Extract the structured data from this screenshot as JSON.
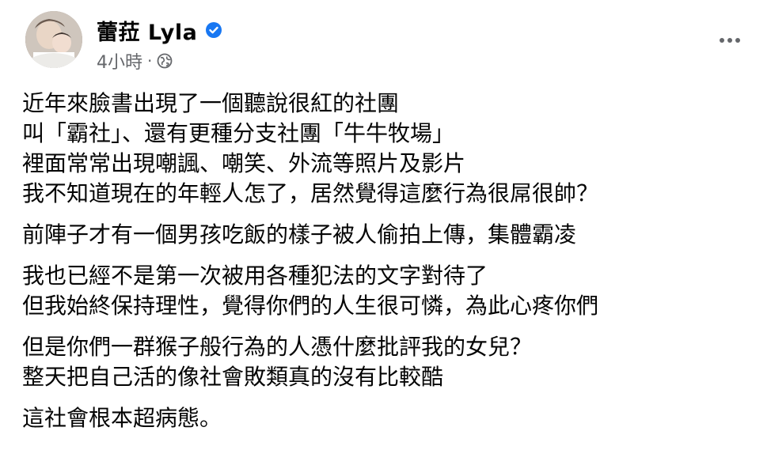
{
  "post": {
    "author": "蕾菈 Lyla",
    "verified": true,
    "time": "4小時",
    "separator": "·",
    "audience_icon": "globe-icon",
    "more_icon": "more-options-icon"
  },
  "body": {
    "paragraphs": [
      {
        "lines": [
          "近年來臉書出現了一個聽說很紅的社團",
          "叫「霸社」、還有更種分支社團「牛牛牧場」",
          "裡面常常出現嘲諷、嘲笑、外流等照片及影片",
          "我不知道現在的年輕人怎了，居然覺得這麼行為很屌很帥？"
        ]
      },
      {
        "lines": [
          "前陣子才有一個男孩吃飯的樣子被人偷拍上傳，集體霸凌"
        ]
      },
      {
        "lines": [
          "我也已經不是第一次被用各種犯法的文字對待了",
          "但我始終保持理性，覺得你們的人生很可憐，為此心疼你們"
        ]
      },
      {
        "lines": [
          "但是你們一群猴子般行為的人憑什麼批評我的女兒？",
          "整天把自己活的像社會敗類真的沒有比較酷"
        ]
      },
      {
        "lines": [
          "這社會根本超病態。"
        ]
      }
    ]
  },
  "colors": {
    "text": "#050505",
    "meta": "#65676b",
    "verified": "#1877f2"
  }
}
